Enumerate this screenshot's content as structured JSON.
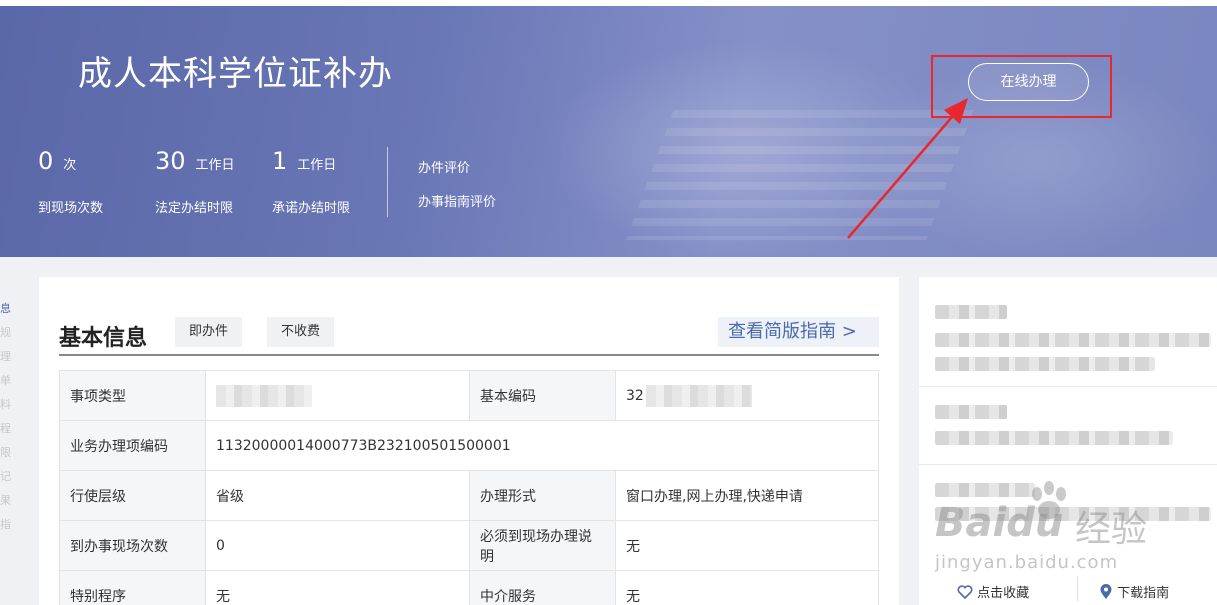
{
  "banner": {
    "title": "成人本科学位证补办",
    "stats": [
      {
        "num": "0",
        "unit": "次",
        "label": "到现场次数"
      },
      {
        "num": "30",
        "unit": "工作日",
        "label": "法定办结时限"
      },
      {
        "num": "1",
        "unit": "工作日",
        "label": "承诺办结时限"
      }
    ],
    "eval_links": [
      "办件评价",
      "办事指南评价"
    ],
    "online_button": "在线办理",
    "annotation_color": "#e9272c"
  },
  "left_strip": [
    "息",
    "规",
    "理",
    "单",
    "料",
    "程",
    "限",
    "记",
    "果",
    "指"
  ],
  "basic_info": {
    "heading": "基本信息",
    "tags": [
      "即办件",
      "不收费"
    ],
    "guide_link": "查看简版指南 >",
    "rows": [
      [
        {
          "label": "事项类型",
          "value": "",
          "redacted": true
        },
        {
          "label": "基本编码",
          "value": "32",
          "redacted": true
        }
      ],
      [
        {
          "label": "业务办理项编码",
          "value": "11320000014000773B232100501500001"
        }
      ],
      [
        {
          "label": "行使层级",
          "value": "省级"
        },
        {
          "label": "办理形式",
          "value": "窗口办理,网上办理,快递申请"
        }
      ],
      [
        {
          "label": "到办事现场次数",
          "value": "0"
        },
        {
          "label": "必须到现场办理说明",
          "value": "无"
        }
      ],
      [
        {
          "label": "特别程序",
          "value": "无"
        },
        {
          "label": "中介服务",
          "value": "无"
        }
      ]
    ]
  },
  "side_panel": {
    "favorite": "点击收藏",
    "download": "下载指南"
  },
  "watermark": {
    "brand": "Baidu",
    "sub": "经验",
    "url": "jingyan.baidu.com"
  },
  "colors": {
    "banner": "#6a77b6",
    "link": "#4a6ab0",
    "annotation": "#e9272c"
  }
}
